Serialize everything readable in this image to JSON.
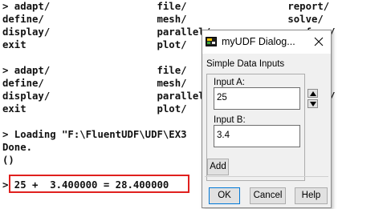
{
  "console": {
    "lines": [
      "> adapt/                  file/                 report/",
      "define/                   mesh/                 solve/",
      "display/                  parallel/             surface/",
      "exit                      plot/                 views/",
      "",
      "> adapt/                  file/                 report/",
      "define/                   mesh/                 solve/",
      "display/                  parallel/             surface/",
      "exit                      plot/                 views/",
      "",
      "> Loading \"F:\\FluentUDF\\UDF\\EX3",
      "Done.",
      "()",
      "",
      "> 25 +  3.400000 = 28.400000"
    ],
    "highlight_color": "#e0201e"
  },
  "dialog": {
    "title": "myUDF Dialog...",
    "app_icon": "dialog-app-icon",
    "close_icon": "close-icon",
    "group_label": "Simple Data Inputs",
    "input_a": {
      "label": "Input A:",
      "value": "25"
    },
    "input_b": {
      "label": "Input B:",
      "value": "3.4"
    },
    "add_label": "Add",
    "ok_label": "OK",
    "cancel_label": "Cancel",
    "help_label": "Help"
  }
}
